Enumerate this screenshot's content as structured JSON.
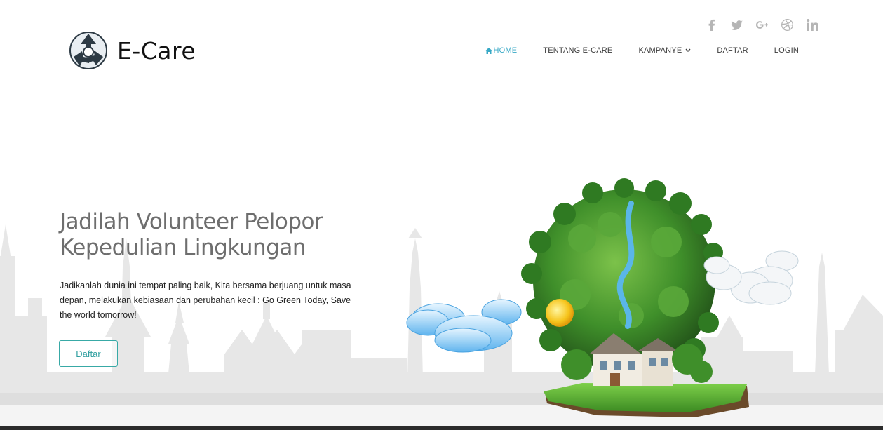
{
  "brand": {
    "name": "E-Care"
  },
  "social": {
    "links": [
      {
        "icon": "facebook-icon",
        "glyph": "f"
      },
      {
        "icon": "twitter-icon",
        "glyph": ""
      },
      {
        "icon": "google-plus-icon",
        "glyph": "g+"
      },
      {
        "icon": "dribbble-icon",
        "glyph": ""
      },
      {
        "icon": "linkedin-icon",
        "glyph": "in"
      }
    ]
  },
  "nav": {
    "home": "HOME",
    "about": "TENTANG E-CARE",
    "campaign": "KAMPANYE",
    "register": "DAFTAR",
    "login": "LOGIN"
  },
  "hero": {
    "title_line1": "Jadilah Volunteer Pelopor",
    "title_line2": "Kepedulian Lingkungan",
    "description": "Jadikanlah dunia ini tempat paling baik, Kita bersama berjuang untuk masa depan, melakukan kebiasaan dan perubahan kecil : Go Green Today, Save the world tomorrow!",
    "button_label": "Daftar"
  },
  "colors": {
    "accent": "#38a9c6",
    "button_border": "#38a9a6",
    "text_dark": "#222222",
    "skyline": "#e6e6e6",
    "social_icon": "#b5b5b5"
  }
}
